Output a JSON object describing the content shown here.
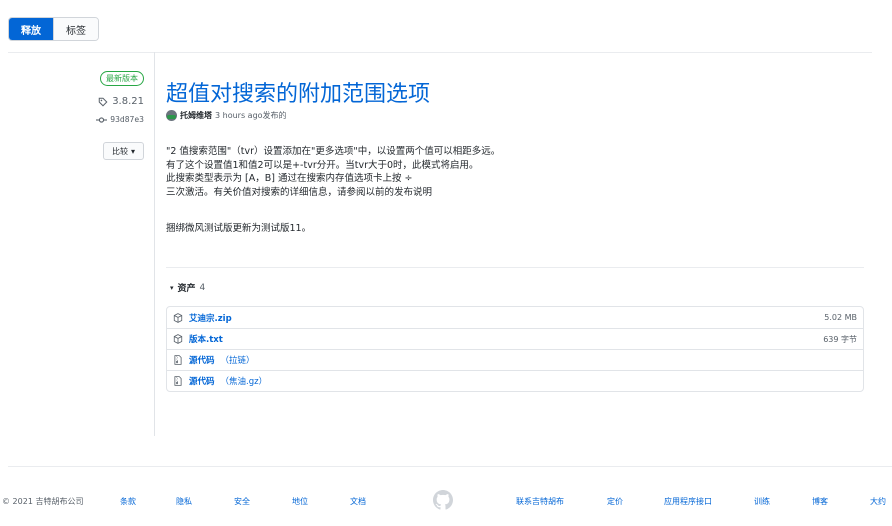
{
  "tabs": [
    {
      "label": "释放",
      "active": true
    },
    {
      "label": "标签",
      "active": false
    }
  ],
  "meta": {
    "latest_badge": "最新版本",
    "tag": "3.8.21",
    "commit": "93d87e3",
    "compare_label": "比较"
  },
  "release": {
    "title": "超值对搜索的附加范围选项",
    "author": "托姆维塔",
    "time_text": "3 hours ago发布的",
    "description_lines": [
      "\"2 值搜索范围\"（tvr）设置添加在\"更多选项\"中，以设置两个值可以相距多远。",
      "有了这个设置值1和值2可以是+-tvr分开。当tvr大于0时，此模式将启用。",
      "此搜索类型表示为 [A，B] 通过在搜索内存值选项卡上按 ÷",
      "三次激活。有关价值对搜索的详细信息，请参阅以前的发布说明"
    ],
    "extra_note": "捆绑微风测试版更新为测试版11。",
    "assets_label": "资产",
    "assets_count": "4",
    "assets": [
      {
        "name": "艾迪宗.zip",
        "sub": "",
        "size": "5.02 MB",
        "icon": "package-icon"
      },
      {
        "name": "版本.txt",
        "sub": "",
        "size": "639 字节",
        "icon": "package-icon"
      },
      {
        "name": "源代码",
        "sub": "（拉链）",
        "size": "",
        "icon": "file-zip-icon"
      },
      {
        "name": "源代码",
        "sub": "（焦油.gz）",
        "size": "",
        "icon": "file-zip-icon"
      }
    ]
  },
  "footer": {
    "copyright": "© 2021 吉特胡布公司",
    "links_left": [
      "条款",
      "隐私",
      "安全",
      "地位",
      "文档"
    ],
    "links_right": [
      "联系吉特胡布",
      "定价",
      "应用程序接口",
      "训练",
      "博客",
      "大约"
    ]
  },
  "colors": {
    "accent": "#0366d6",
    "latest_green": "#28a745",
    "border": "#e1e4e8"
  }
}
